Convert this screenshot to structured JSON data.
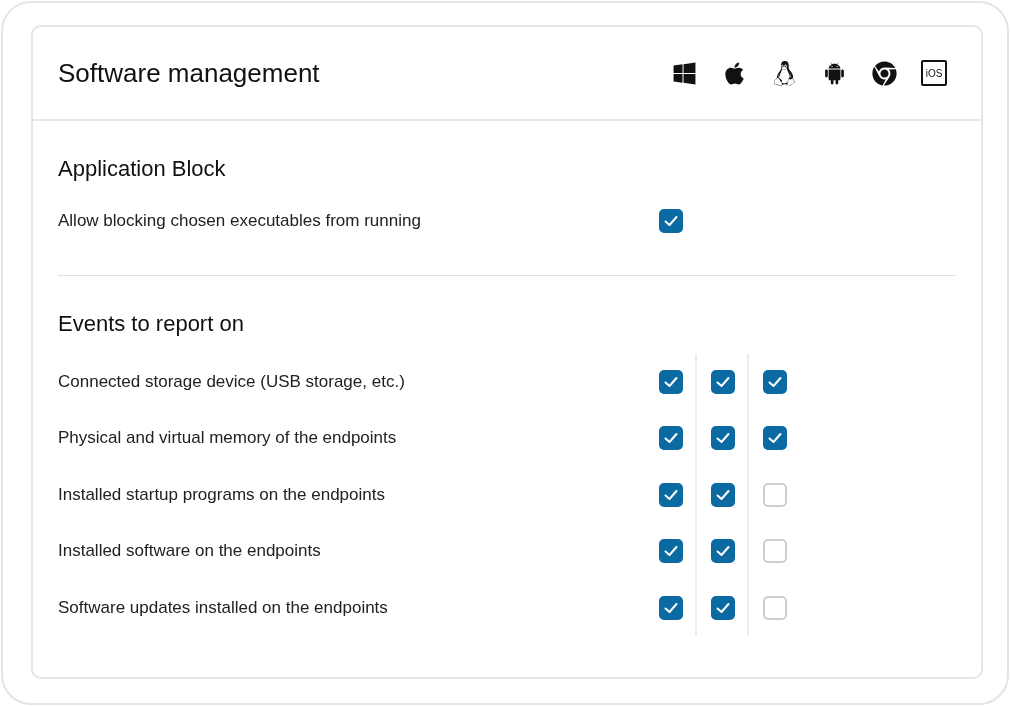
{
  "header": {
    "title": "Software management",
    "platforms": [
      {
        "kind": "windows"
      },
      {
        "kind": "apple"
      },
      {
        "kind": "linux"
      },
      {
        "kind": "android"
      },
      {
        "kind": "chrome"
      },
      {
        "kind": "ios",
        "label": "iOS"
      }
    ]
  },
  "sections": [
    {
      "title": "Application Block",
      "rows": [
        {
          "label": "Allow blocking chosen executables from running",
          "checks": [
            true
          ]
        }
      ]
    },
    {
      "title": "Events to report on",
      "rows": [
        {
          "label": "Connected storage device (USB storage, etc.)",
          "checks": [
            true,
            true,
            true
          ]
        },
        {
          "label": "Physical and virtual memory of the endpoints",
          "checks": [
            true,
            true,
            true
          ]
        },
        {
          "label": "Installed startup programs on the endpoints",
          "checks": [
            true,
            true,
            false
          ]
        },
        {
          "label": "Installed software on the endpoints",
          "checks": [
            true,
            true,
            false
          ]
        },
        {
          "label": "Software updates installed on the endpoints",
          "checks": [
            true,
            true,
            false
          ]
        }
      ]
    }
  ]
}
